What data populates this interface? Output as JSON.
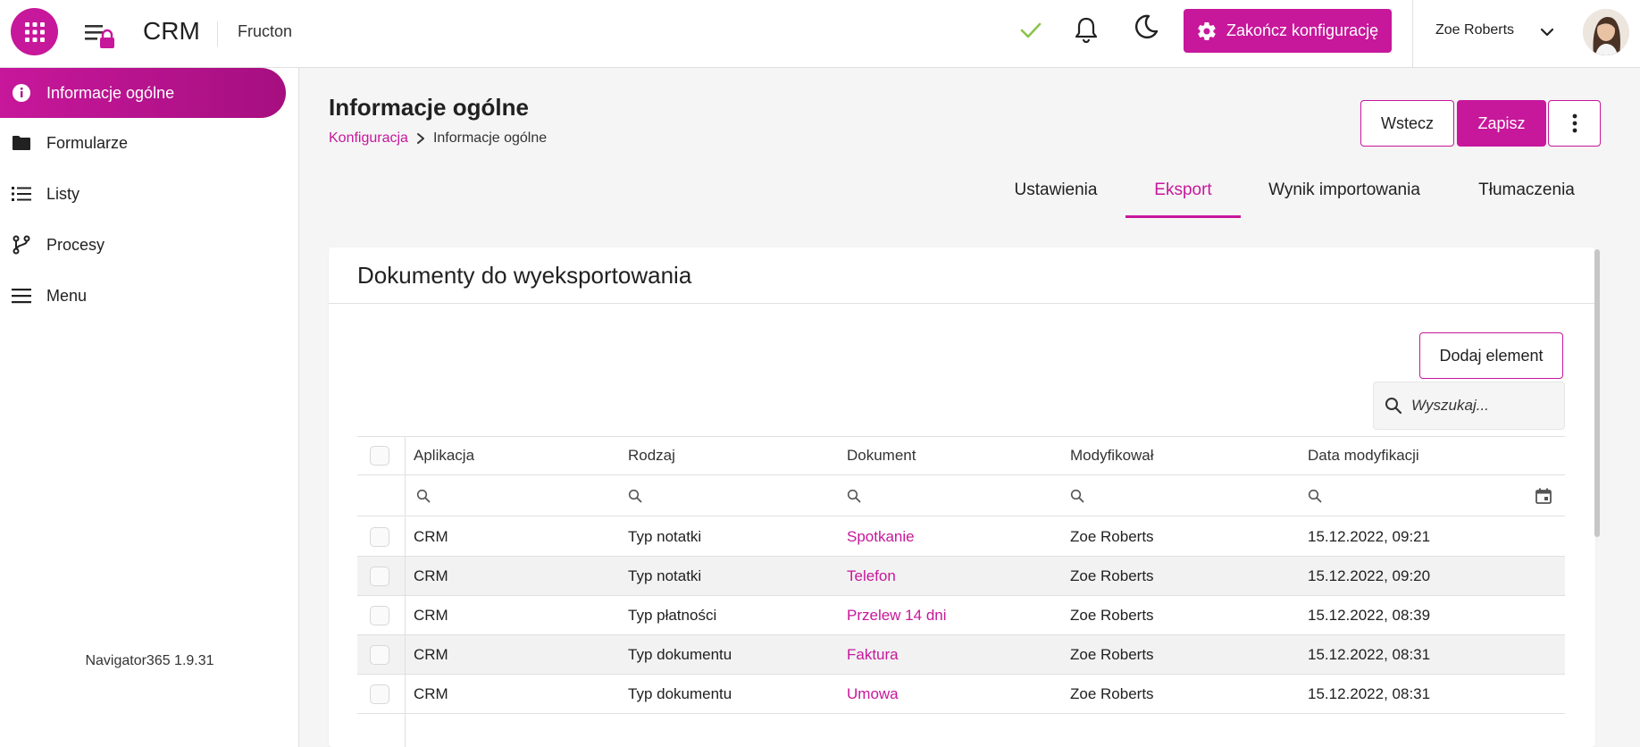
{
  "header": {
    "app_title": "CRM",
    "company": "Fructon",
    "finish_config_label": "Zakończ konfigurację",
    "user_name": "Zoe Roberts",
    "colors": {
      "accent": "#c7179b",
      "success": "#8bc34a"
    }
  },
  "sidebar": {
    "items": [
      {
        "label": "Informacje ogólne",
        "icon": "info-icon",
        "active": true
      },
      {
        "label": "Formularze",
        "icon": "folder-icon",
        "active": false
      },
      {
        "label": "Listy",
        "icon": "list-icon",
        "active": false
      },
      {
        "label": "Procesy",
        "icon": "branch-icon",
        "active": false
      },
      {
        "label": "Menu",
        "icon": "menu-icon",
        "active": false
      }
    ],
    "version": "Navigator365 1.9.31"
  },
  "page": {
    "title": "Informacje ogólne",
    "breadcrumb": {
      "parent": "Konfiguracja",
      "current": "Informacje ogólne"
    },
    "actions": {
      "back_label": "Wstecz",
      "save_label": "Zapisz"
    },
    "tabs": [
      {
        "label": "Ustawienia",
        "active": false
      },
      {
        "label": "Eksport",
        "active": true
      },
      {
        "label": "Wynik importowania",
        "active": false
      },
      {
        "label": "Tłumaczenia",
        "active": false
      }
    ]
  },
  "card": {
    "title": "Dokumenty do wyeksportowania",
    "add_label": "Dodaj element",
    "search_placeholder": "Wyszukaj...",
    "columns": [
      "Aplikacja",
      "Rodzaj",
      "Dokument",
      "Modyfikował",
      "Data modyfikacji"
    ],
    "rows": [
      {
        "app": "CRM",
        "type": "Typ notatki",
        "doc": "Spotkanie",
        "by": "Zoe Roberts",
        "date": "15.12.2022, 09:21"
      },
      {
        "app": "CRM",
        "type": "Typ notatki",
        "doc": "Telefon",
        "by": "Zoe Roberts",
        "date": "15.12.2022, 09:20"
      },
      {
        "app": "CRM",
        "type": "Typ płatności",
        "doc": "Przelew 14 dni",
        "by": "Zoe Roberts",
        "date": "15.12.2022, 08:39"
      },
      {
        "app": "CRM",
        "type": "Typ dokumentu",
        "doc": "Faktura",
        "by": "Zoe Roberts",
        "date": "15.12.2022, 08:31"
      },
      {
        "app": "CRM",
        "type": "Typ dokumentu",
        "doc": "Umowa",
        "by": "Zoe Roberts",
        "date": "15.12.2022, 08:31"
      }
    ]
  }
}
